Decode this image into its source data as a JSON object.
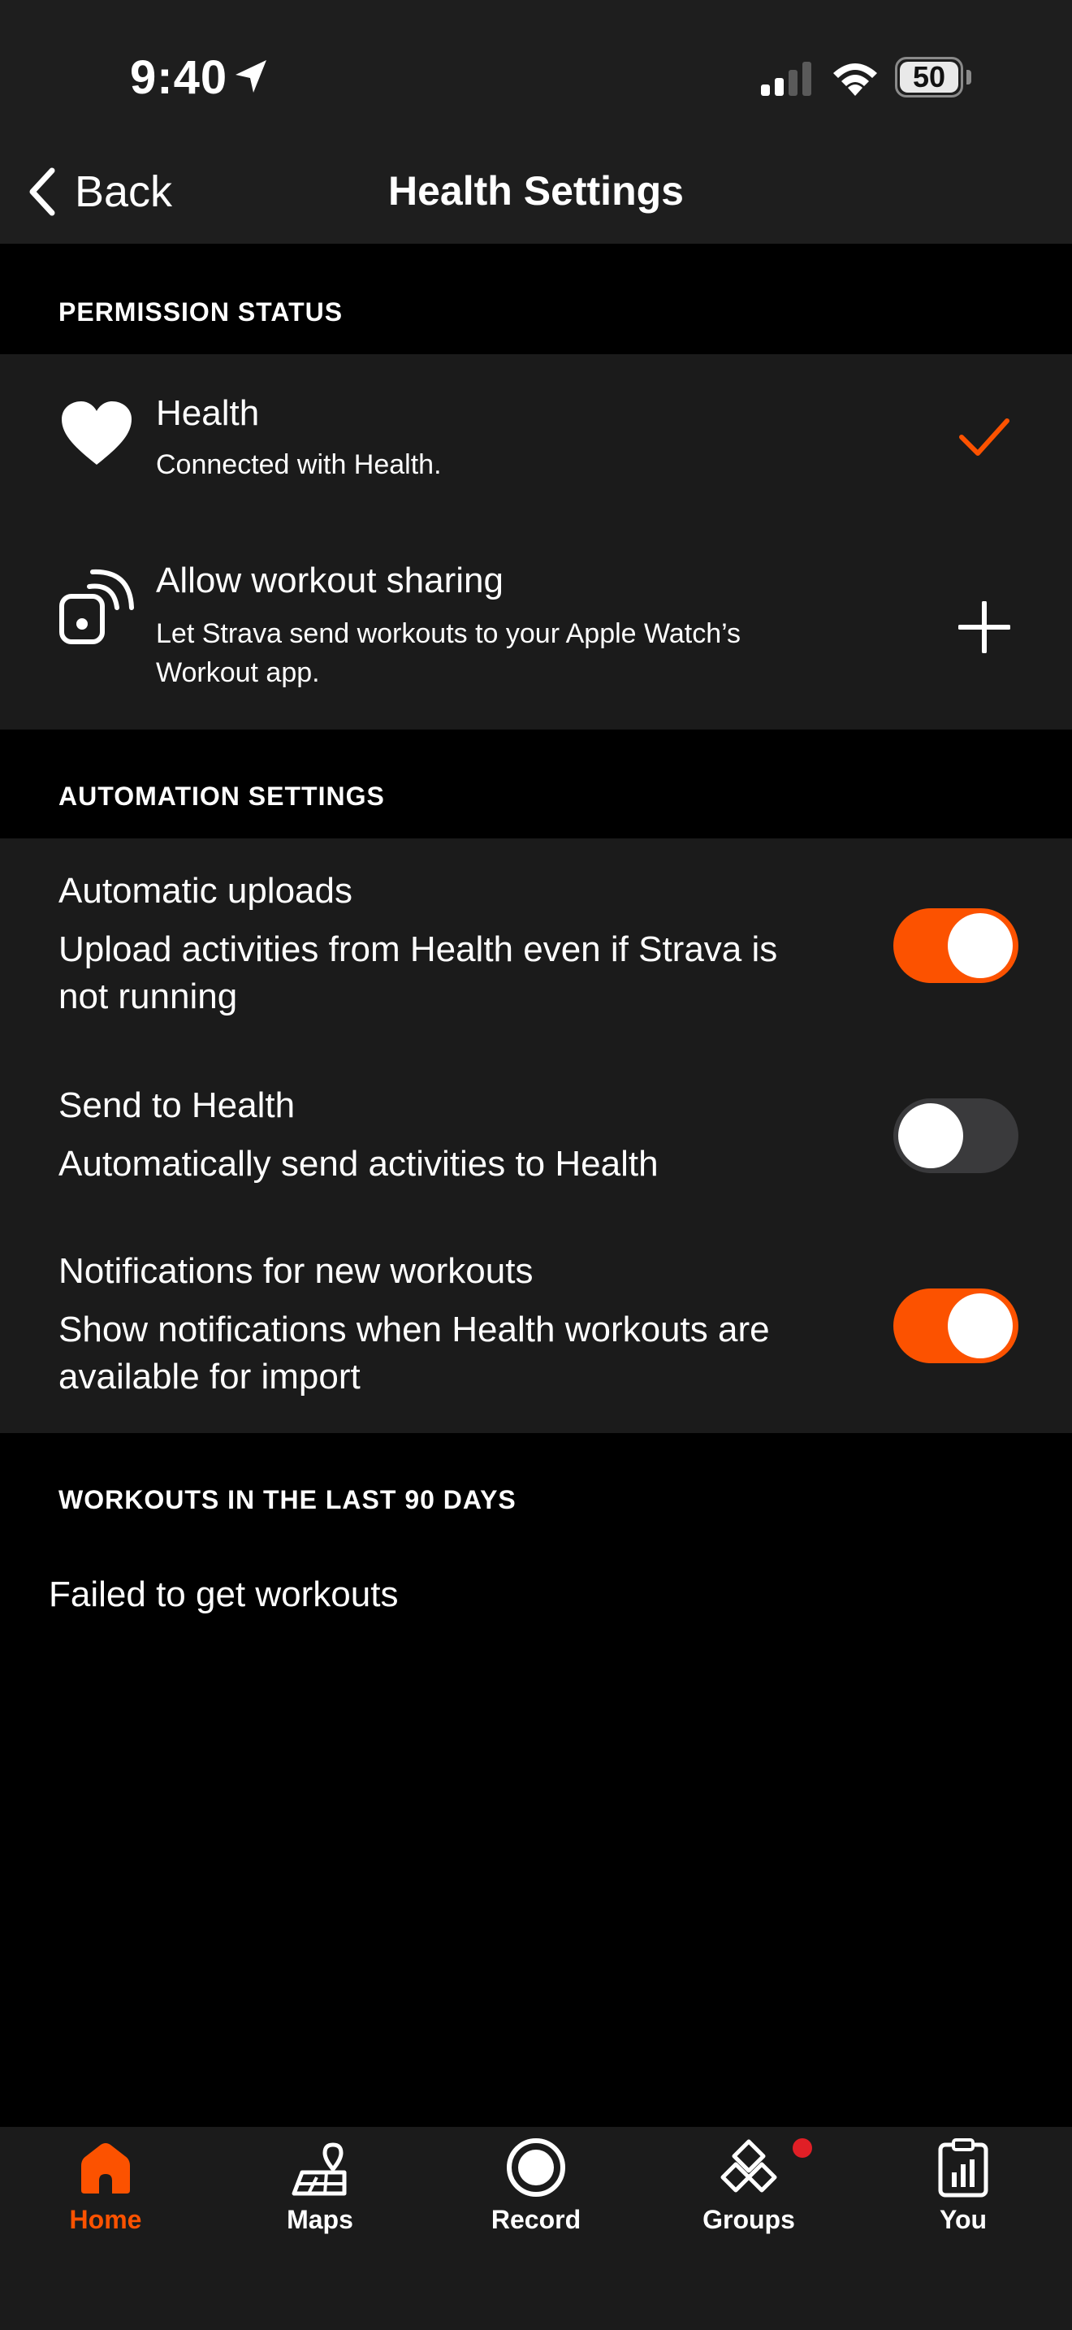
{
  "status_bar": {
    "time": "9:40",
    "battery": "50"
  },
  "nav": {
    "back_label": "Back",
    "title": "Health Settings"
  },
  "permission": {
    "header": "PERMISSION STATUS",
    "items": [
      {
        "title": "Health",
        "subtitle": "Connected with Health.",
        "status": "connected"
      },
      {
        "title": "Allow workout sharing",
        "subtitle_line1": "Let Strava send workouts to your Apple Watch’s",
        "subtitle_line2": "Workout app.",
        "status": "add"
      }
    ]
  },
  "automation": {
    "header": "AUTOMATION SETTINGS",
    "items": [
      {
        "title": "Automatic uploads",
        "desc_line1": "Upload activities from Health even if Strava is",
        "desc_line2": "not running",
        "enabled": true
      },
      {
        "title": "Send to Health",
        "desc_line1": "Automatically send activities to Health",
        "enabled": false
      },
      {
        "title": "Notifications for new workouts",
        "desc_line1": "Show notifications when Health workouts are",
        "desc_line2": "available for import",
        "enabled": true
      }
    ]
  },
  "workouts": {
    "header": "WORKOUTS IN THE LAST 90 DAYS",
    "message": "Failed to get workouts"
  },
  "tabbar": {
    "tabs": [
      {
        "label": "Home",
        "icon": "home-icon",
        "active": true
      },
      {
        "label": "Maps",
        "icon": "maps-icon",
        "active": false
      },
      {
        "label": "Record",
        "icon": "record-icon",
        "active": false
      },
      {
        "label": "Groups",
        "icon": "groups-icon",
        "active": false,
        "badge": true
      },
      {
        "label": "You",
        "icon": "you-icon",
        "active": false
      }
    ]
  },
  "colors": {
    "accent": "#fc5200",
    "background": "#000000",
    "panel": "#1b1b1b",
    "toggle_off": "#3a3a3c",
    "badge": "#e01f26"
  }
}
